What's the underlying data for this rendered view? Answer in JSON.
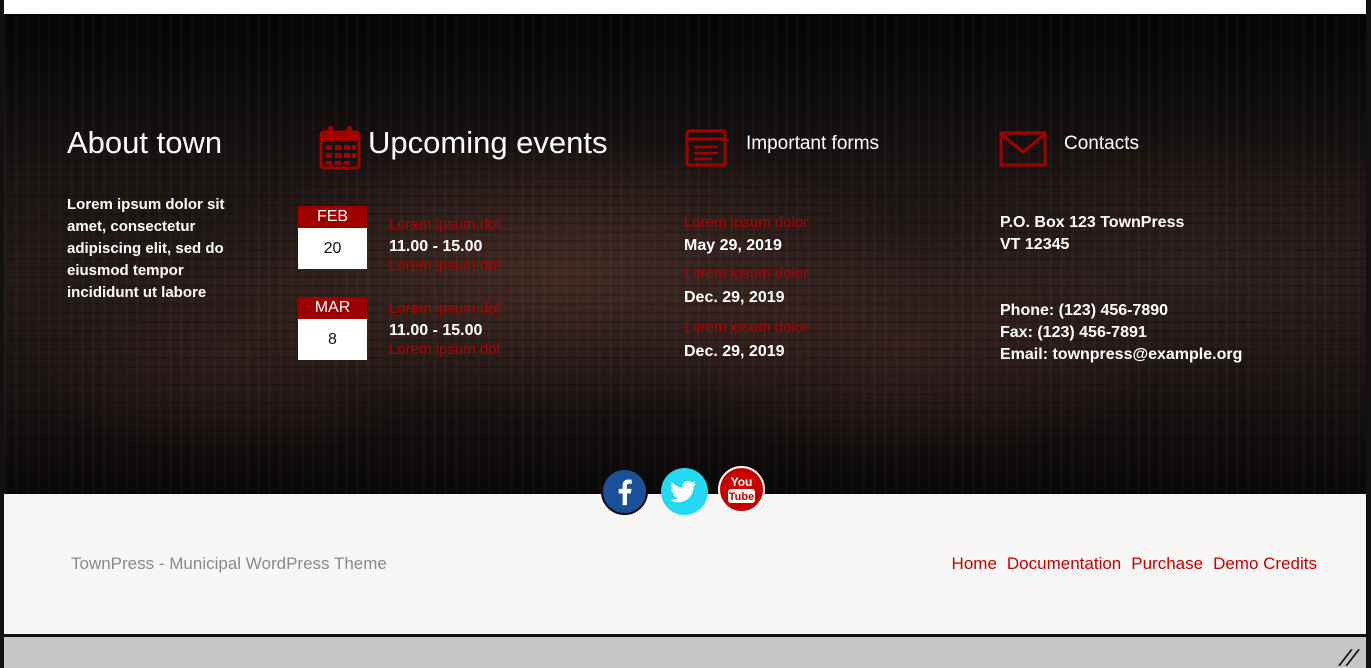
{
  "about": {
    "title": "About town",
    "text": "Lorem ipsum dolor sit amet, consectetur adipiscing elit, sed do eiusmod tempor incididunt ut labore"
  },
  "events": {
    "title": "Upcoming events",
    "icon": "calendar-icon",
    "items": [
      {
        "month": "FEB",
        "day": "20",
        "link_label": "Lorem ipsum dol",
        "time": "11.00 - 15.00",
        "subtitle": "Lorem ipsum dol"
      },
      {
        "month": "MAR",
        "day": "8",
        "link_label": "Lorem ipsum dol",
        "time": "11.00 - 15.00",
        "subtitle": "Lorem ipsum dol"
      }
    ]
  },
  "forms": {
    "title": "Important forms",
    "icon": "forms-icon",
    "items": [
      {
        "label": "Lorem ipsum dolor",
        "date": "May 29, 2019"
      },
      {
        "label": "Lorem ipsum dolor",
        "date": "Dec. 29, 2019"
      },
      {
        "label": "Lorem ipsum dolor",
        "date": "Dec. 29, 2019"
      }
    ]
  },
  "contacts": {
    "title": "Contacts",
    "icon": "envelope-icon",
    "address_line1": "P.O. Box 123 TownPress",
    "address_line2": "VT 12345",
    "phone": "Phone: (123) 456-7890",
    "fax": "Fax: (123) 456-7891",
    "email": "Email: townpress@example.org"
  },
  "social": {
    "facebook_icon": "facebook-icon",
    "twitter_icon": "twitter-icon",
    "youtube_icon": "youtube-icon",
    "youtube_text_top": "You",
    "youtube_text_bottom": "Tube"
  },
  "footer": {
    "copyright": "TownPress - Municipal WordPress Theme",
    "nav": [
      "Home",
      "Documentation",
      "Purchase",
      "Demo Credits"
    ]
  },
  "colors": {
    "accent": "#b30000",
    "date_header": "#9e0000",
    "footer_bg": "#f7f6f5",
    "facebook": "#1b4f9a",
    "twitter": "#22d9f2",
    "youtube": "#c80000"
  }
}
